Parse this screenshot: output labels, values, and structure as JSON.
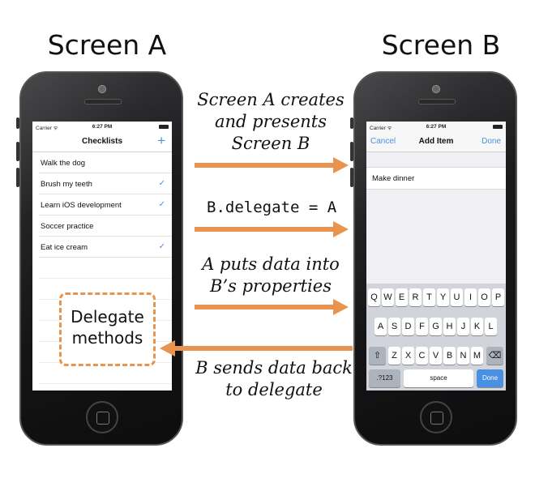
{
  "titles": {
    "screen_a": "Screen A",
    "screen_b": "Screen B"
  },
  "arrows": [
    {
      "label_lines": [
        "Screen A creates",
        "and presents",
        "Screen B"
      ],
      "direction": "right"
    },
    {
      "label": "B.delegate = A",
      "direction": "right"
    },
    {
      "label_lines": [
        "A puts data into",
        "B’s properties"
      ],
      "direction": "right"
    },
    {
      "label_lines": [
        "B sends data back",
        "to delegate"
      ],
      "direction": "left"
    }
  ],
  "delegate_box": {
    "line1": "Delegate",
    "line2": "methods"
  },
  "colors": {
    "arrow": "#e8944f",
    "ios_blue": "#4a90e2"
  },
  "screen_a": {
    "status": {
      "carrier": "Carrier ᯤ",
      "time": "6:27 PM"
    },
    "nav": {
      "title": "Checklists",
      "add": "+"
    },
    "items": [
      {
        "text": "Walk the dog",
        "checked": false
      },
      {
        "text": "Brush my teeth",
        "checked": true
      },
      {
        "text": "Learn iOS development",
        "checked": true
      },
      {
        "text": "Soccer practice",
        "checked": false
      },
      {
        "text": "Eat ice cream",
        "checked": true
      }
    ],
    "checkmark": "✓"
  },
  "screen_b": {
    "status": {
      "carrier": "Carrier ᯤ",
      "time": "6:27 PM"
    },
    "nav": {
      "cancel": "Cancel",
      "title": "Add Item",
      "done": "Done"
    },
    "field_value": "Make dinner",
    "keyboard": {
      "row1": [
        "Q",
        "W",
        "E",
        "R",
        "T",
        "Y",
        "U",
        "I",
        "O",
        "P"
      ],
      "row2": [
        "A",
        "S",
        "D",
        "F",
        "G",
        "H",
        "J",
        "K",
        "L"
      ],
      "row3": [
        "Z",
        "X",
        "C",
        "V",
        "B",
        "N",
        "M"
      ],
      "shift": "⇧",
      "backspace": "⌫",
      "numbers": ".?123",
      "space": "space",
      "done": "Done"
    }
  }
}
